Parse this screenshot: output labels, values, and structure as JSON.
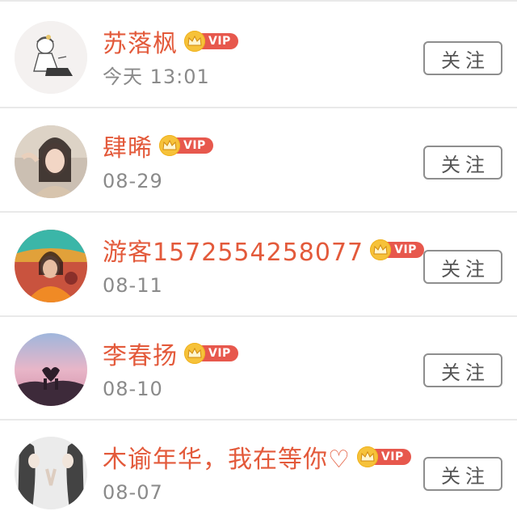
{
  "users": [
    {
      "name": "苏落枫",
      "time": "今天 13:01",
      "badge": "VIP",
      "follow_label": "关注"
    },
    {
      "name": "肆晞",
      "time": "08-29",
      "badge": "VIP",
      "follow_label": "关注"
    },
    {
      "name": "游客1572554258077",
      "time": "08-11",
      "badge": "VIP",
      "follow_label": "关注"
    },
    {
      "name": "李春扬",
      "time": "08-10",
      "badge": "VIP",
      "follow_label": "关注"
    },
    {
      "name": "木谕年华，我在等你♡",
      "time": "08-07",
      "badge": "VIP",
      "follow_label": "关注"
    }
  ],
  "colors": {
    "name": "#e35a3b",
    "vip_badge": "#e7584d",
    "crown": "#f6c23a",
    "time": "#8a8a8a",
    "divider": "#e9e9e9",
    "button_border": "#8e8e8e"
  },
  "icons": {
    "badge_icon": "crown-icon"
  }
}
